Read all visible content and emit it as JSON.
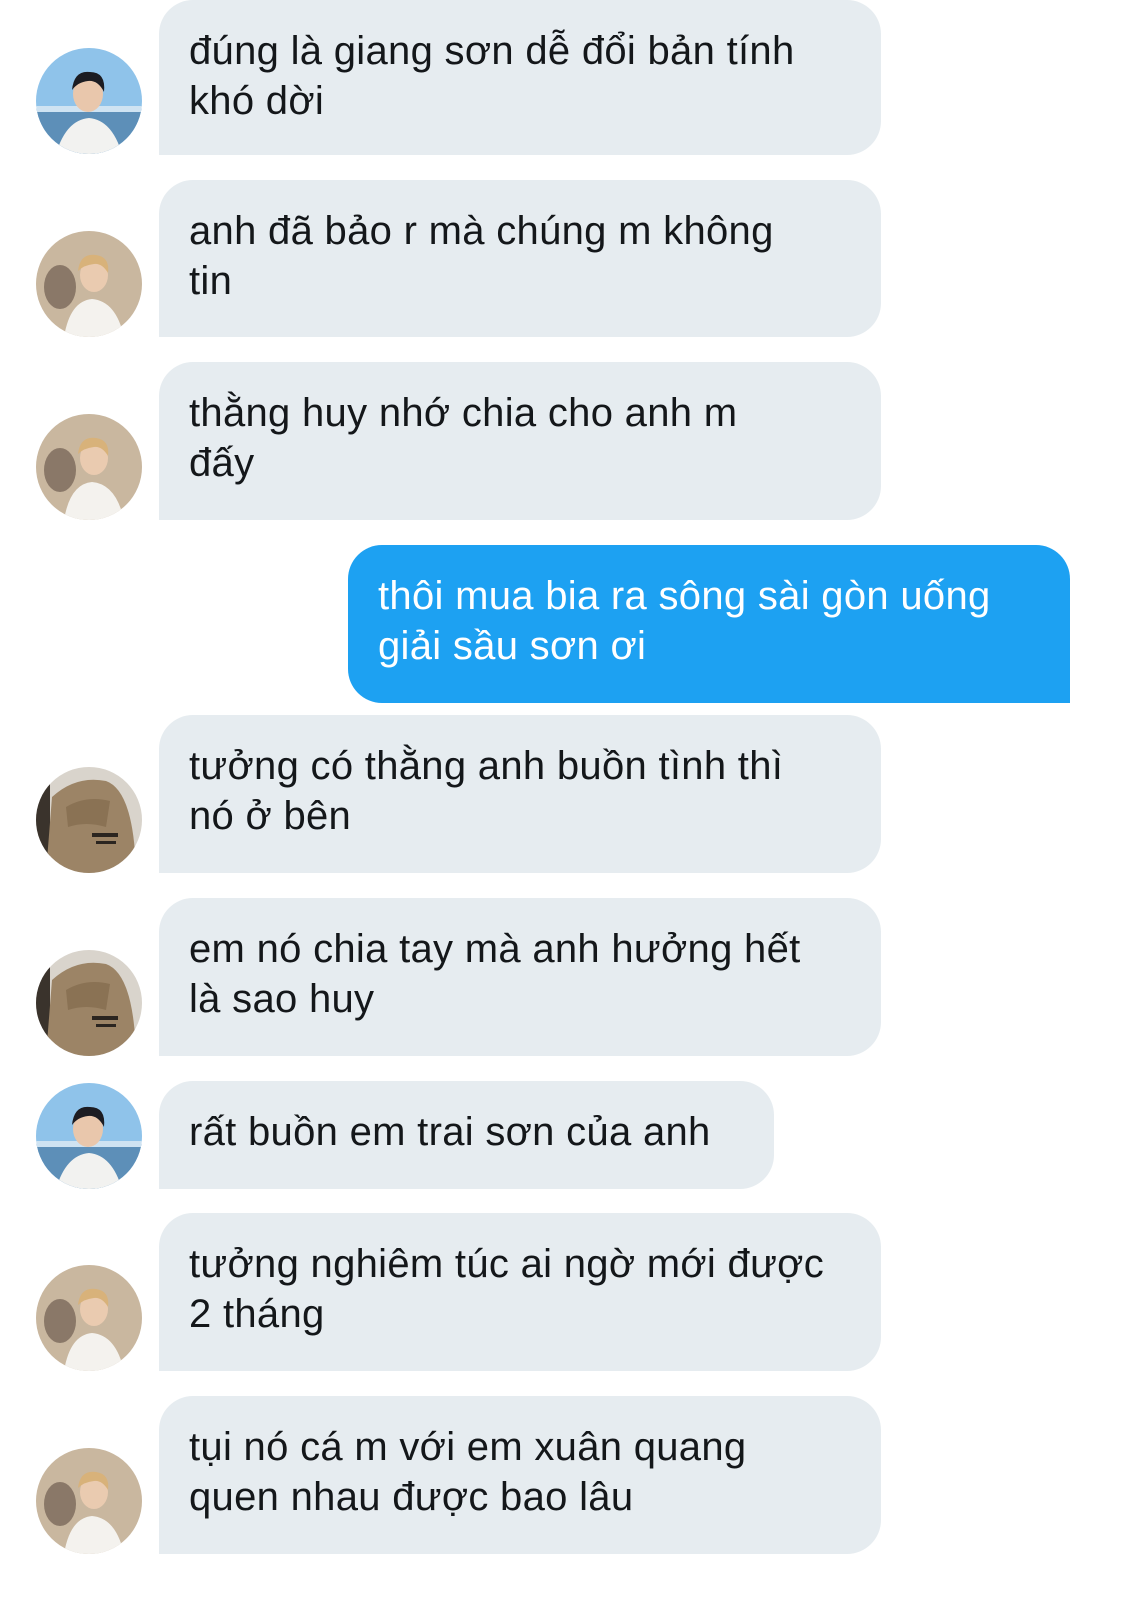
{
  "conversation": {
    "messages": [
      {
        "sender": "incoming",
        "avatar": "avatar-sea-boy",
        "text": "đúng là giang sơn dễ đổi bản tính\nkhó dời"
      },
      {
        "sender": "incoming",
        "avatar": "avatar-white-shirt",
        "text": "anh đã bảo r mà chúng m không\ntin"
      },
      {
        "sender": "incoming",
        "avatar": "avatar-white-shirt",
        "text": "thằng huy nhớ chia cho anh m\nđấy"
      },
      {
        "sender": "outgoing",
        "avatar": null,
        "text": "thôi mua bia ra sông sài gòn uống\ngiải sầu sơn ơi"
      },
      {
        "sender": "incoming",
        "avatar": "avatar-hoodie",
        "text": "tưởng có thằng anh buồn tình thì\nnó ở bên"
      },
      {
        "sender": "incoming",
        "avatar": "avatar-hoodie",
        "text": "em nó chia tay mà anh hưởng hết\nlà sao huy"
      },
      {
        "sender": "incoming",
        "avatar": "avatar-sea-boy",
        "text": "rất buồn em trai sơn của anh"
      },
      {
        "sender": "incoming",
        "avatar": "avatar-white-shirt",
        "text": "tưởng nghiêm túc ai ngờ mới được\n2 tháng"
      },
      {
        "sender": "incoming",
        "avatar": "avatar-white-shirt",
        "text": "tụi nó cá m với em xuân quang\nquen nhau được bao lâu"
      }
    ]
  },
  "colors": {
    "incoming_bubble": "#e6ecf0",
    "outgoing_bubble": "#1da1f2",
    "incoming_text": "#14171a",
    "outgoing_text": "#ffffff"
  }
}
